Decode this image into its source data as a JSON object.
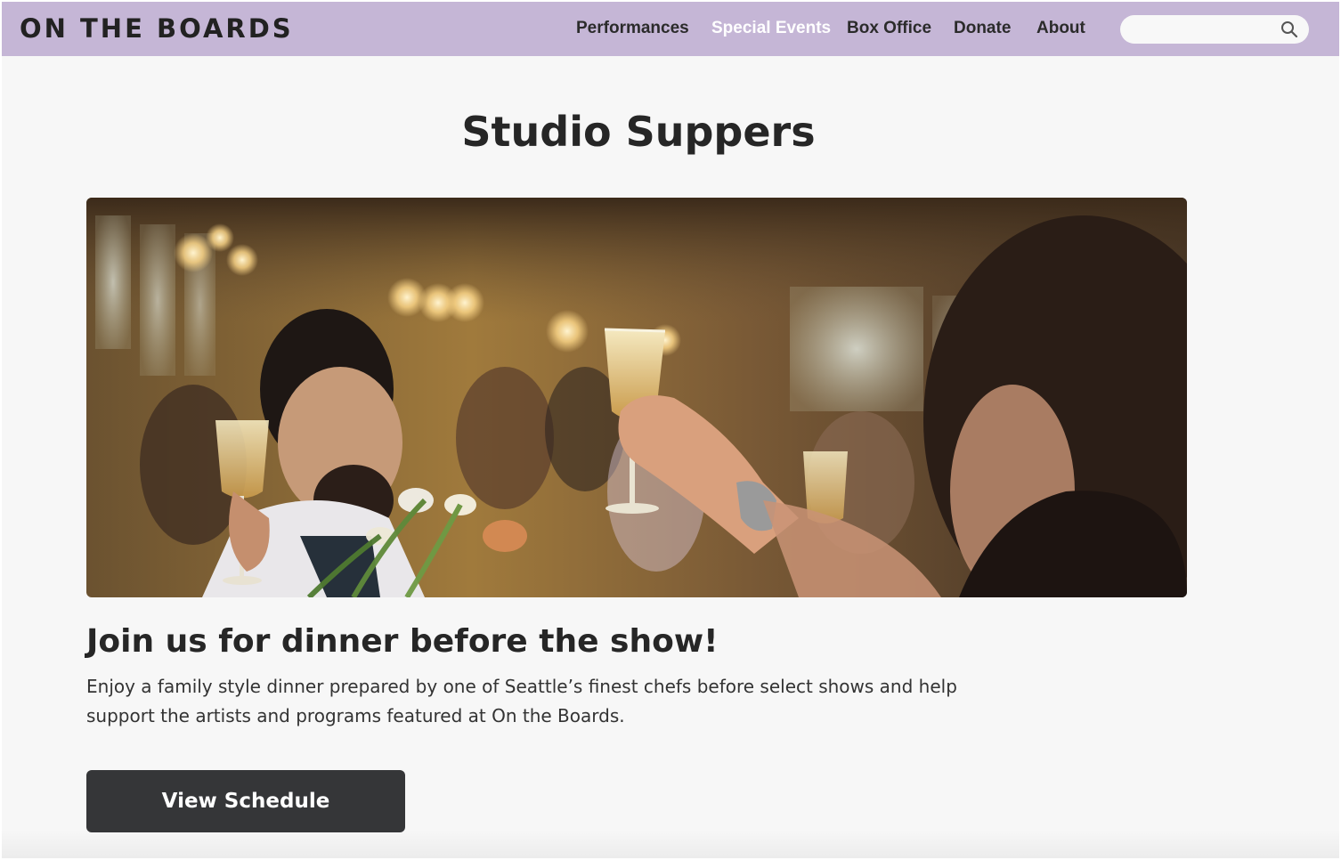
{
  "header": {
    "logo": "ON THE BOARDS",
    "nav": [
      {
        "label": "Performances",
        "active": false
      },
      {
        "label": "Special Events",
        "active": true
      },
      {
        "label": "Box Office",
        "active": false
      },
      {
        "label": "Donate",
        "active": false
      },
      {
        "label": "About",
        "active": false
      }
    ],
    "search": {
      "placeholder": "",
      "value": "",
      "icon": "search-icon"
    }
  },
  "main": {
    "title": "Studio Suppers",
    "hero_image": {
      "description_icon": "dinner-toast-photo"
    },
    "subheading": "Join us for dinner before the show!",
    "description": "Enjoy a family style dinner prepared by one of Seattle’s finest chefs before select shows and help support the artists and programs featured at On the Boards.",
    "cta_label": "View Schedule"
  },
  "colors": {
    "navbar": "#c5b6d6",
    "background": "#f7f7f7",
    "button": "#353638",
    "text": "#262626"
  }
}
